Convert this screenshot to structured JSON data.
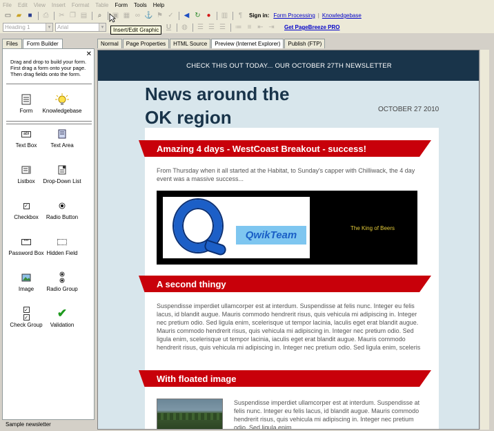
{
  "menu": {
    "items": [
      {
        "label": "File",
        "enabled": false
      },
      {
        "label": "Edit",
        "enabled": false
      },
      {
        "label": "View",
        "enabled": false
      },
      {
        "label": "Insert",
        "enabled": false
      },
      {
        "label": "Format",
        "enabled": false
      },
      {
        "label": "Table",
        "enabled": false
      },
      {
        "label": "Form",
        "enabled": true
      },
      {
        "label": "Tools",
        "enabled": true
      },
      {
        "label": "Help",
        "enabled": true
      }
    ]
  },
  "toolbar": {
    "sign_in_label": "Sign in:",
    "form_processing_link": "Form Processing",
    "separator": "|",
    "knowledgebase_link": "Knowledgebase",
    "style_combo": "Heading 1",
    "font_combo": "Arial",
    "get_pro_link": "Get PageBreeze PRO",
    "tooltip": "Insert/Edit Graphic",
    "underline_label": "U"
  },
  "left_panel": {
    "tabs": [
      "Files",
      "Form Builder"
    ],
    "active_tab": "Form Builder",
    "close_glyph": "✕",
    "instructions": "Drag and drop to build your form. First drag a form onto your page. Then drag fields onto the form.",
    "top_items": [
      {
        "label": "Form",
        "icon": "form-icon"
      },
      {
        "label": "Knowledgebase",
        "icon": "lightbulb-icon"
      }
    ],
    "field_items": [
      {
        "label": "Text Box",
        "icon": "textbox-icon"
      },
      {
        "label": "Text Area",
        "icon": "textarea-icon"
      },
      {
        "label": "Listbox",
        "icon": "listbox-icon"
      },
      {
        "label": "Drop-Down List",
        "icon": "dropdown-icon"
      },
      {
        "label": "Checkbox",
        "icon": "checkbox-icon"
      },
      {
        "label": "Radio Button",
        "icon": "radio-icon"
      },
      {
        "label": "Password Box",
        "icon": "password-icon"
      },
      {
        "label": "Hidden Field",
        "icon": "hidden-field-icon"
      },
      {
        "label": "Image",
        "icon": "image-icon"
      },
      {
        "label": "Radio Group",
        "icon": "radio-group-icon"
      },
      {
        "label": "Check Group",
        "icon": "check-group-icon"
      },
      {
        "label": "Validation",
        "icon": "checkmark-icon"
      }
    ],
    "textbox_glyph": "abl",
    "password_glyph": "***",
    "check_glyph": "✓",
    "validation_glyph": "✔",
    "status": "Sample newsletter"
  },
  "editor_tabs": [
    "Normal",
    "Page Properties",
    "HTML Source",
    "Preview (Internet Explorer)",
    "Publish (FTP)"
  ],
  "active_editor_tab": "Preview (Internet Explorer)",
  "newsletter": {
    "banner": "CHECK THIS OUT TODAY... OUR OCTOBER 27TH NEWSLETTER",
    "title_line1": "News around the",
    "title_line2": "OK region",
    "date": "OCTOBER 27 2010",
    "sections": [
      {
        "heading": "Amazing 4 days - WestCoast Breakout - success!",
        "body": "From Thursday when it all started at the Habitat, to Sunday's capper with Chilliwack, the 4 day event was a massive success..."
      },
      {
        "heading": "A second thingy",
        "body": "Suspendisse imperdiet ullamcorper est at interdum. Suspendisse at felis nunc. Integer eu felis lacus, id blandit augue. Mauris commodo hendrerit risus, quis vehicula mi adipiscing in. Integer nec pretium odio. Sed ligula enim, scelerisque ut tempor lacinia, laculis eget erat blandit augue. Mauris commodo hendrerit risus, quis vehicula mi adipiscing in. Integer nec pretium odio. Sed ligula enim, scelerisque ut tempor lacinia, iaculis eget erat blandit augue. Mauris commodo hendrerit risus, quis vehicula mi adipiscing in. Integer nec pretium odio. Sed ligula enim, sceleris"
      },
      {
        "heading": "With floated image",
        "body": "Suspendisse imperdiet ullamcorper est at interdum. Suspendisse at felis nunc. Integer eu felis lacus, id blandit augue. Mauris commodo hendrerit risus, quis vehicula mi adipiscing in. Integer nec pretium odio. Sed ligula enim"
      }
    ],
    "logo_text": "QwikTeam",
    "image_caption": "The King of Beers"
  },
  "colors": {
    "banner_bg": "#19344a",
    "section_red": "#c8000a",
    "preview_bg": "#d8e6ec",
    "link_blue": "#0000c8"
  }
}
